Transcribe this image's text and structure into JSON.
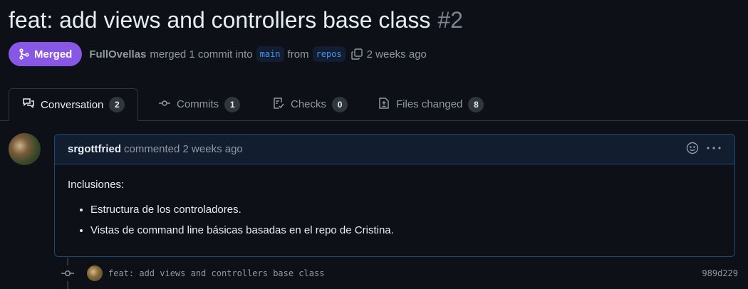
{
  "pr": {
    "title": "feat: add views and controllers base class",
    "number": "#2"
  },
  "meta": {
    "status": "Merged",
    "author": "FullOvellas",
    "action": "merged 1 commit into",
    "base_branch": "main",
    "from_word": "from",
    "head_branch": "repos",
    "time": "2 weeks ago"
  },
  "tabs": [
    {
      "label": "Conversation",
      "count": "2",
      "icon": "comment-discussion-icon"
    },
    {
      "label": "Commits",
      "count": "1",
      "icon": "git-commit-icon"
    },
    {
      "label": "Checks",
      "count": "0",
      "icon": "checklist-icon"
    },
    {
      "label": "Files changed",
      "count": "8",
      "icon": "file-diff-icon"
    }
  ],
  "comment": {
    "user": "srgottfried",
    "action": "commented 2 weeks ago",
    "body_intro": "Inclusiones:",
    "items": [
      "Estructura de los controladores.",
      "Vistas de command line básicas basadas en el repo de Cristina."
    ]
  },
  "commit": {
    "message": "feat: add views and controllers base class",
    "sha": "989d229"
  },
  "colors": {
    "merged_purple": "#8957e5",
    "background": "#0d1117",
    "comment_border": "#1f4976",
    "comment_header_bg": "#121d2f",
    "link_blue": "#4493f8"
  }
}
